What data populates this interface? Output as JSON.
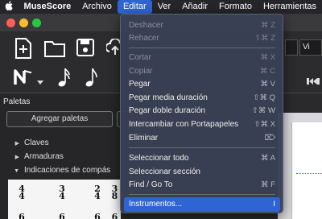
{
  "menubar": {
    "app_name": "MuseScore",
    "items": [
      "Archivo",
      "Editar",
      "Ver",
      "Añadir",
      "Formato",
      "Herramientas"
    ]
  },
  "toolbar": {
    "select_value": "Vi"
  },
  "palettes": {
    "title": "Paletas",
    "add_button": "Agregar paletas",
    "sections": [
      "Claves",
      "Armaduras",
      "Indicaciones de compás"
    ],
    "time_signatures": [
      {
        "num": "4",
        "den": "4"
      },
      {
        "num": "3",
        "den": "4"
      },
      {
        "num": "2",
        "den": "4"
      },
      {
        "num": "3",
        "den": "8"
      }
    ],
    "bottom_row": [
      "6",
      "6",
      "6",
      "6"
    ]
  },
  "edit_menu": {
    "items": [
      {
        "label": "Deshacer",
        "shortcut": "⌘ Z",
        "enabled": false
      },
      {
        "label": "Rehacer",
        "shortcut": "⇧⌘ Z",
        "enabled": false
      },
      {
        "label": "Cortar",
        "shortcut": "⌘ X",
        "enabled": false
      },
      {
        "label": "Copiar",
        "shortcut": "⌘ C",
        "enabled": false
      },
      {
        "label": "Pegar",
        "shortcut": "⌘ V",
        "enabled": true
      },
      {
        "label": "Pegar media duración",
        "shortcut": "⇧⌘ Q",
        "enabled": true
      },
      {
        "label": "Pegar doble duración",
        "shortcut": "⇧⌘ W",
        "enabled": true
      },
      {
        "label": "Intercambiar con Portapapeles",
        "shortcut": "⇧⌘ X",
        "enabled": true
      },
      {
        "label": "Eliminar",
        "shortcut": "⌦",
        "enabled": true
      },
      {
        "label": "Seleccionar todo",
        "shortcut": "⌘ A",
        "enabled": true
      },
      {
        "label": "Seleccionar sección",
        "shortcut": "",
        "enabled": true
      },
      {
        "label": "Find / Go To",
        "shortcut": "⌘ F",
        "enabled": true
      },
      {
        "label": "Instrumentos...",
        "shortcut": "I",
        "enabled": true,
        "highlighted": true
      }
    ]
  }
}
